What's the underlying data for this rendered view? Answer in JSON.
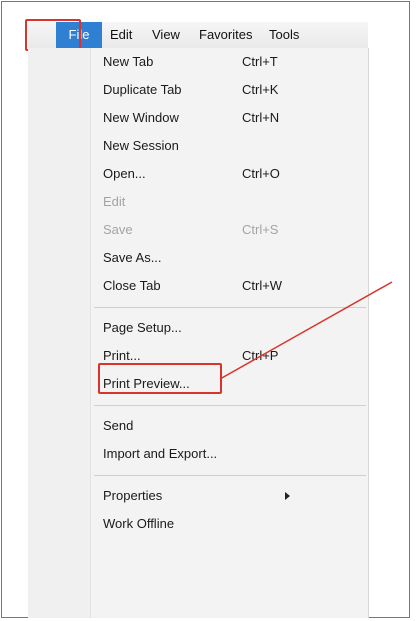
{
  "menubar": {
    "file": "File",
    "edit": "Edit",
    "view": "View",
    "favorites": "Favorites",
    "tools": "Tools"
  },
  "file_menu": {
    "new_tab": {
      "label": "New Tab",
      "shortcut": "Ctrl+T"
    },
    "duplicate_tab": {
      "label": "Duplicate Tab",
      "shortcut": "Ctrl+K"
    },
    "new_window": {
      "label": "New Window",
      "shortcut": "Ctrl+N"
    },
    "new_session": {
      "label": "New Session"
    },
    "open": {
      "label": "Open...",
      "shortcut": "Ctrl+O"
    },
    "edit": {
      "label": "Edit"
    },
    "save": {
      "label": "Save",
      "shortcut": "Ctrl+S"
    },
    "save_as": {
      "label": "Save As..."
    },
    "close_tab": {
      "label": "Close Tab",
      "shortcut": "Ctrl+W"
    },
    "page_setup": {
      "label": "Page Setup..."
    },
    "print": {
      "label": "Print...",
      "shortcut": "Ctrl+P"
    },
    "print_preview": {
      "label": "Print Preview..."
    },
    "send": {
      "label": "Send"
    },
    "import_export": {
      "label": "Import and Export..."
    },
    "properties": {
      "label": "Properties"
    },
    "work_offline": {
      "label": "Work Offline"
    }
  },
  "colors": {
    "highlight_red": "#d9342b",
    "file_selected_blue": "#2f7fd3",
    "frame_blue": "#3b86c6",
    "disabled_text": "#a4a4a4"
  }
}
